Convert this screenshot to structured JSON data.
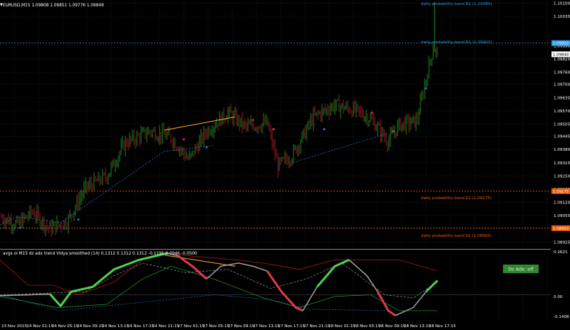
{
  "chart": {
    "header": "EURUSD,M15  1.09808 1.09851 1.09776 1.09848",
    "colors": {
      "background": "#000000",
      "grid": "#1c2a3c",
      "bull": "#22a82a",
      "bear": "#c0202a",
      "r_band": "#2a9ee6",
      "s_band": "#e85a10",
      "trend": "#f0962a",
      "dash": "#2f6fcc",
      "current_price": "#ffffff"
    }
  },
  "price_axis": {
    "labels": [
      "1.10100",
      "1.10035",
      "1.09890",
      "1.09825",
      "1.09760",
      "1.09700",
      "1.09635",
      "1.09570",
      "1.09505",
      "1.09445",
      "1.09380",
      "1.09315",
      "1.09250",
      "1.09185",
      "1.09120",
      "1.09055",
      "1.08990",
      "1.08925"
    ],
    "current_price": "1.09848",
    "r1_tag": "1.09903",
    "s1_tag": "1.09175",
    "s2_tag": "1.08993"
  },
  "bands": [
    {
      "label": "daily probability band R2 (1.10085)",
      "color": "#2a9ee6"
    },
    {
      "label": "daily probability band R1 (1.09903)",
      "color": "#2a9ee6"
    },
    {
      "label": "daily probability band S1 (1.09175)",
      "color": "#e85a10"
    },
    {
      "label": "daily probability band S2 (1.08993)",
      "color": "#e85a10"
    }
  ],
  "indicator": {
    "title": "avgs ol M15 dz adx trend Vidya smoothed (14) 0.1312 0.1312 0.1312 -0.1195 0.0946 -0.0500",
    "axis_labels": [
      "0.2621",
      "0.00",
      "-0.1408"
    ],
    "status_badge": "Dz Adx: off"
  },
  "time_axis": {
    "labels": [
      "23 Nov 2023",
      "24 Nov 01:15",
      "24 Nov 05:15",
      "24 Nov 09:15",
      "24 Nov 13:15",
      "24 Nov 17:15",
      "24 Nov 21:15",
      "27 Nov 01:15",
      "27 Nov 05:15",
      "27 Nov 09:15",
      "27 Nov 13:15",
      "27 Nov 17:15",
      "27 Nov 21:15",
      "28 Nov 01:15",
      "28 Nov 05:15",
      "28 Nov 09:15",
      "28 Nov 13:15",
      "28 Nov 17:15"
    ]
  }
}
